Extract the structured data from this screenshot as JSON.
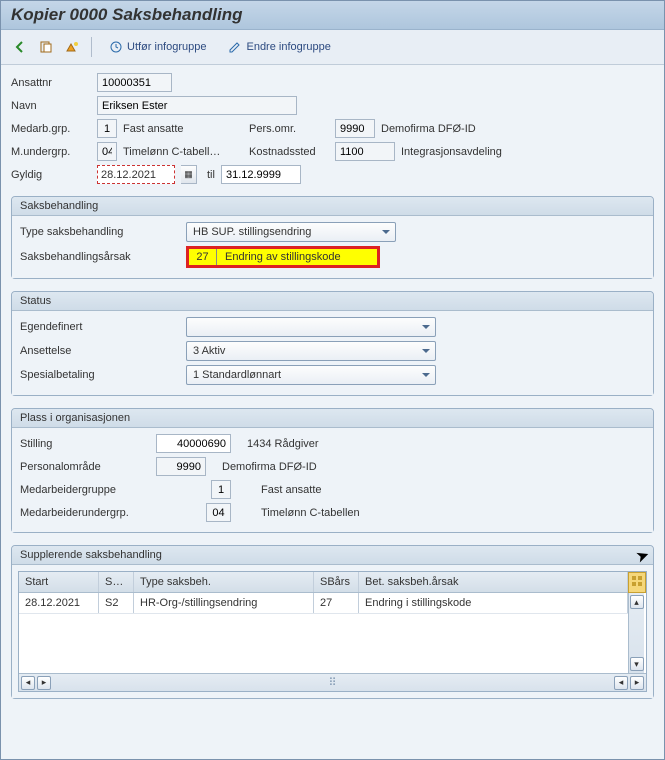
{
  "window": {
    "title": "Kopier 0000 Saksbehandling"
  },
  "toolbar": {
    "utfor": "Utfør infogruppe",
    "endre": "Endre infogruppe"
  },
  "header": {
    "labels": {
      "ansattnr": "Ansattnr",
      "navn": "Navn",
      "medarbgrp": "Medarb.grp.",
      "persomr": "Pers.omr.",
      "mundergrp": "M.undergrp.",
      "kostnadssted": "Kostnadssted",
      "gyldig": "Gyldig",
      "til": "til"
    },
    "ansattnr": "10000351",
    "navn": "Eriksen Ester",
    "medarbgrp_code": "1",
    "medarbgrp_text": "Fast ansatte",
    "persomr_code": "9990",
    "persomr_text": "Demofirma DFØ-ID",
    "mundergrp_code": "04",
    "mundergrp_text": "Timelønn C-tabell…",
    "kostnadssted_code": "1100",
    "kostnadssted_text": "Integrasjonsavdeling",
    "gyldig_fra": "28.12.2021",
    "gyldig_til": "31.12.9999"
  },
  "saksbehandling": {
    "title": "Saksbehandling",
    "type_label": "Type saksbehandling",
    "type_value": "HB SUP. stillingsendring",
    "arsak_label": "Saksbehandlingsårsak",
    "arsak_code": "27",
    "arsak_text": "Endring av stillingskode"
  },
  "status": {
    "title": "Status",
    "egendef_label": "Egendefinert",
    "egendef_value": "",
    "ansettelse_label": "Ansettelse",
    "ansettelse_value": "3 Aktiv",
    "spesial_label": "Spesialbetaling",
    "spesial_value": "1 Standardlønnart"
  },
  "plass": {
    "title": "Plass i organisasjonen",
    "stilling_label": "Stilling",
    "stilling_code": "40000690",
    "stilling_text": "1434 Rådgiver",
    "persomr_label": "Personalområde",
    "persomr_code": "9990",
    "persomr_text": "Demofirma DFØ-ID",
    "medgrp_label": "Medarbeidergruppe",
    "medgrp_code": "1",
    "medgrp_text": "Fast ansatte",
    "medugrp_label": "Medarbeiderundergrp.",
    "medugrp_code": "04",
    "medugrp_text": "Timelønn C-tabellen"
  },
  "supp": {
    "title": "Supplerende saksbehandling",
    "columns": {
      "start": "Start",
      "sa": "Sa…",
      "type": "Type saksbeh.",
      "sbars": "SBårs",
      "bet": "Bet. saksbeh.årsak"
    },
    "rows": [
      {
        "start": "28.12.2021",
        "sa": "S2",
        "type": "HR-Org-/stillingsendring",
        "sbars": "27",
        "bet": "Endring i stillingskode"
      }
    ]
  }
}
